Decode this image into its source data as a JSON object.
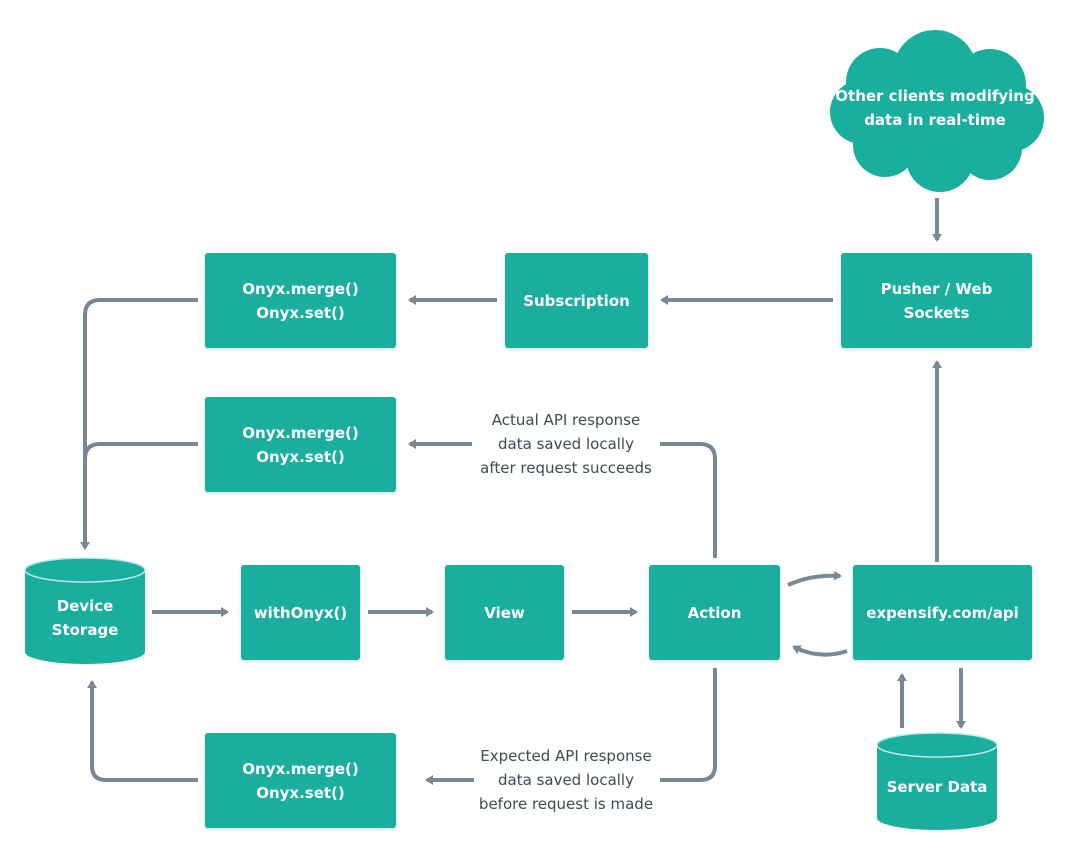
{
  "colors": {
    "node_fill": "#1aae9f",
    "node_rim": "#bfeae4",
    "edge": "#788896",
    "caption_text": "#3e4a56",
    "node_text": "#ffffff"
  },
  "nodes": {
    "cloud": {
      "label": "Other clients modifying\ndata in real-time",
      "shape": "cloud"
    },
    "pusher": {
      "label": "Pusher / Web\nSockets",
      "shape": "box"
    },
    "subscription": {
      "label": "Subscription",
      "shape": "box"
    },
    "onyx_top": {
      "label": "Onyx.merge()\nOnyx.set()",
      "shape": "box"
    },
    "onyx_mid": {
      "label": "Onyx.merge()\nOnyx.set()",
      "shape": "box"
    },
    "onyx_bottom": {
      "label": "Onyx.merge()\nOnyx.set()",
      "shape": "box"
    },
    "device_storage": {
      "label": "Device\nStorage",
      "shape": "cylinder"
    },
    "with_onyx": {
      "label": "withOnyx()",
      "shape": "box"
    },
    "view": {
      "label": "View",
      "shape": "box"
    },
    "action": {
      "label": "Action",
      "shape": "box"
    },
    "api": {
      "label": "expensify.com/api",
      "shape": "box"
    },
    "server_data": {
      "label": "Server Data",
      "shape": "cylinder"
    }
  },
  "captions": {
    "actual_response": "Actual API response\ndata saved locally\nafter request succeeds",
    "expected_response": "Expected API response\ndata saved locally\nbefore request is made"
  },
  "edges": [
    {
      "from": "cloud",
      "to": "pusher"
    },
    {
      "from": "pusher",
      "to": "subscription"
    },
    {
      "from": "subscription",
      "to": "onyx_top"
    },
    {
      "from": "onyx_top",
      "to": "device_storage"
    },
    {
      "from": "onyx_mid",
      "to": "device_storage"
    },
    {
      "from": "onyx_bottom",
      "to": "device_storage"
    },
    {
      "from": "device_storage",
      "to": "with_onyx"
    },
    {
      "from": "with_onyx",
      "to": "view"
    },
    {
      "from": "view",
      "to": "action"
    },
    {
      "from": "action",
      "to": "api"
    },
    {
      "from": "api",
      "to": "action"
    },
    {
      "from": "api",
      "to": "pusher"
    },
    {
      "from": "api",
      "to": "server_data"
    },
    {
      "from": "server_data",
      "to": "api"
    },
    {
      "from": "action",
      "to": "onyx_mid",
      "label": "actual_response"
    },
    {
      "from": "action",
      "to": "onyx_bottom",
      "label": "expected_response"
    }
  ]
}
